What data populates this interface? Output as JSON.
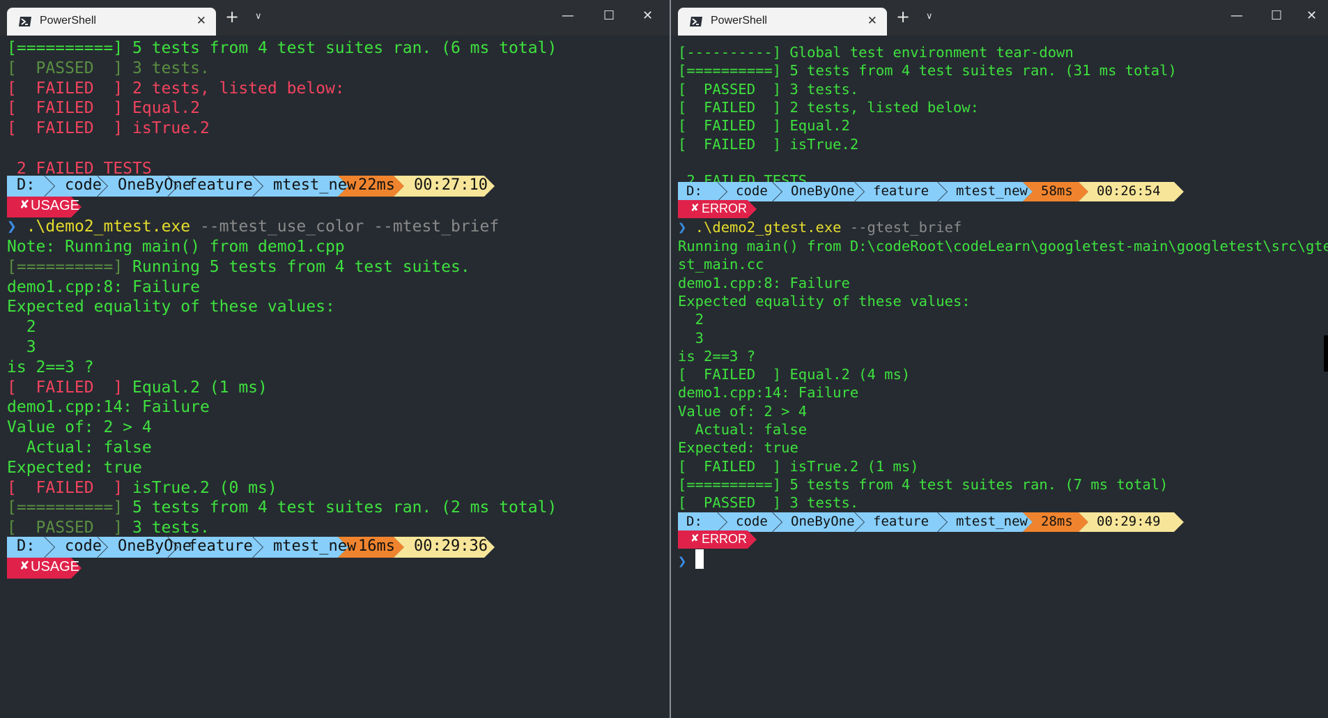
{
  "left": {
    "tab_title": "PowerShell",
    "scroll_top": [
      [
        {
          "t": "[==========] 5 tests from 4 test suites ran. (6 ms total)",
          "c": ""
        }
      ],
      [
        {
          "t": "[  PASSED  ] 3 tests.",
          "c": "c-dim"
        }
      ],
      [
        {
          "t": "[  FAILED  ] 2 tests, listed below:",
          "c": "c-red"
        }
      ],
      [
        {
          "t": "[  FAILED  ] Equal.2",
          "c": "c-red"
        }
      ],
      [
        {
          "t": "[  FAILED  ] isTrue.2",
          "c": "c-red"
        }
      ],
      [
        {
          "t": "",
          "c": ""
        }
      ],
      [
        {
          "t": " 2 FAILED TESTS",
          "c": "c-red"
        }
      ]
    ],
    "prompt1": {
      "segs": [
        "D:",
        "code",
        "OneByOne",
        "feature",
        "mtest_new"
      ],
      "time_ms": "22ms",
      "clock": "00:27:10",
      "status": "USAGE"
    },
    "command": {
      "exe": ".\\demo2_mtest.exe",
      "args": " --mtest_use_color --mtest_brief"
    },
    "output": [
      [
        {
          "t": "Note: Running main() from demo1.cpp",
          "c": ""
        }
      ],
      [
        {
          "t": "[==========] ",
          "c": "c-dim"
        },
        {
          "t": "Running 5 tests from 4 test suites.",
          "c": ""
        }
      ],
      [
        {
          "t": "demo1.cpp:8: Failure",
          "c": ""
        }
      ],
      [
        {
          "t": "Expected equality of these values:",
          "c": ""
        }
      ],
      [
        {
          "t": "  2",
          "c": ""
        }
      ],
      [
        {
          "t": "  3",
          "c": ""
        }
      ],
      [
        {
          "t": "is 2==3 ?",
          "c": ""
        }
      ],
      [
        {
          "t": "[  FAILED  ] ",
          "c": "c-red"
        },
        {
          "t": "Equal.2 (1 ms)",
          "c": ""
        }
      ],
      [
        {
          "t": "demo1.cpp:14: Failure",
          "c": ""
        }
      ],
      [
        {
          "t": "Value of: 2 > 4",
          "c": ""
        }
      ],
      [
        {
          "t": "  Actual: false",
          "c": ""
        }
      ],
      [
        {
          "t": "Expected: true",
          "c": ""
        }
      ],
      [
        {
          "t": "[  FAILED  ] ",
          "c": "c-red"
        },
        {
          "t": "isTrue.2 (0 ms)",
          "c": ""
        }
      ],
      [
        {
          "t": "[==========] ",
          "c": "c-dim"
        },
        {
          "t": "5 tests from 4 test suites ran. (2 ms total)",
          "c": ""
        }
      ],
      [
        {
          "t": "[  PASSED  ] ",
          "c": "c-dim"
        },
        {
          "t": "3 tests.",
          "c": ""
        }
      ]
    ],
    "prompt2": {
      "segs": [
        "D:",
        "code",
        "OneByOne",
        "feature",
        "mtest_new"
      ],
      "time_ms": "16ms",
      "clock": "00:29:36",
      "status": "USAGE"
    }
  },
  "right": {
    "tab_title": "PowerShell",
    "scroll_top": [
      [
        {
          "t": "[----------] Global test environment tear-down",
          "c": ""
        }
      ],
      [
        {
          "t": "[==========] 5 tests from 4 test suites ran. (31 ms total)",
          "c": ""
        }
      ],
      [
        {
          "t": "[  PASSED  ] 3 tests.",
          "c": ""
        }
      ],
      [
        {
          "t": "[  FAILED  ] 2 tests, listed below:",
          "c": ""
        }
      ],
      [
        {
          "t": "[  FAILED  ] Equal.2",
          "c": ""
        }
      ],
      [
        {
          "t": "[  FAILED  ] isTrue.2",
          "c": ""
        }
      ],
      [
        {
          "t": "",
          "c": ""
        }
      ],
      [
        {
          "t": " 2 FAILED TESTS",
          "c": ""
        }
      ]
    ],
    "prompt1": {
      "segs": [
        "D:",
        "code",
        "OneByOne",
        "feature",
        "mtest_new"
      ],
      "time_ms": "58ms",
      "clock": "00:26:54",
      "status": "ERROR"
    },
    "command": {
      "exe": ".\\demo2_gtest.exe",
      "args": " --gtest_brief"
    },
    "output": [
      [
        {
          "t": "Running main() from D:\\codeRoot\\codeLearn\\googletest-main\\googletest\\src\\gte",
          "c": ""
        }
      ],
      [
        {
          "t": "st_main.cc",
          "c": ""
        }
      ],
      [
        {
          "t": "demo1.cpp:8: Failure",
          "c": ""
        }
      ],
      [
        {
          "t": "Expected equality of these values:",
          "c": ""
        }
      ],
      [
        {
          "t": "  2",
          "c": ""
        }
      ],
      [
        {
          "t": "  3",
          "c": ""
        }
      ],
      [
        {
          "t": "is 2==3 ?",
          "c": ""
        }
      ],
      [
        {
          "t": "[  FAILED  ] Equal.2 (4 ms)",
          "c": ""
        }
      ],
      [
        {
          "t": "demo1.cpp:14: Failure",
          "c": ""
        }
      ],
      [
        {
          "t": "Value of: 2 > 4",
          "c": ""
        }
      ],
      [
        {
          "t": "  Actual: false",
          "c": ""
        }
      ],
      [
        {
          "t": "Expected: true",
          "c": ""
        }
      ],
      [
        {
          "t": "[  FAILED  ] isTrue.2 (1 ms)",
          "c": ""
        }
      ],
      [
        {
          "t": "[==========] 5 tests from 4 test suites ran. (7 ms total)",
          "c": ""
        }
      ],
      [
        {
          "t": "[  PASSED  ] 3 tests.",
          "c": ""
        }
      ]
    ],
    "prompt2": {
      "segs": [
        "D:",
        "code",
        "OneByOne",
        "feature",
        "mtest_new"
      ],
      "time_ms": "28ms",
      "clock": "00:29:49",
      "status": "ERROR"
    }
  },
  "window_controls": {
    "minimize": "—",
    "maximize": "☐",
    "close": "✕"
  },
  "icons": {
    "tab": "powershell-icon",
    "close": "close-icon",
    "new_tab": "plus-icon",
    "dropdown": "chevron-down-icon",
    "status": "x-mark-icon",
    "prompt": "chevron-right-icon"
  },
  "colors": {
    "background": "#262b31",
    "output_green": "#3ee13e",
    "failed_red": "#f2435e",
    "path_blue": "#87cefa",
    "time_orange": "#f0842e",
    "clock_yellow": "#f7e69a",
    "status_red": "#e0224a",
    "tab_bg": "#f3f3f3"
  }
}
